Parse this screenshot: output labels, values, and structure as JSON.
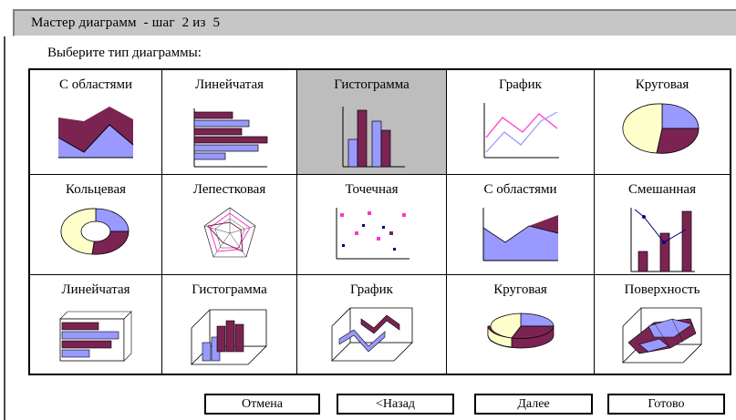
{
  "window": {
    "title": "Мастер диаграмм  - шаг  2 из  5"
  },
  "prompt": "Выберите тип диаграммы:",
  "chart_types": [
    {
      "label": "С областями",
      "icon": "area-chart-icon"
    },
    {
      "label": "Линейчатая",
      "icon": "bar-chart-icon"
    },
    {
      "label": "Гистограмма",
      "icon": "column-chart-icon",
      "selected": true
    },
    {
      "label": "График",
      "icon": "line-chart-icon"
    },
    {
      "label": "Круговая",
      "icon": "pie-chart-icon"
    },
    {
      "label": "Кольцевая",
      "icon": "doughnut-chart-icon"
    },
    {
      "label": "Лепестковая",
      "icon": "radar-chart-icon"
    },
    {
      "label": "Точечная",
      "icon": "scatter-chart-icon"
    },
    {
      "label": "С областями",
      "icon": "area-3d-chart-icon"
    },
    {
      "label": "Смешанная",
      "icon": "combo-chart-icon"
    },
    {
      "label": "Линейчатая",
      "icon": "bar-3d-chart-icon"
    },
    {
      "label": "Гистограмма",
      "icon": "column-3d-chart-icon"
    },
    {
      "label": "График",
      "icon": "line-3d-chart-icon"
    },
    {
      "label": "Круговая",
      "icon": "pie-3d-chart-icon"
    },
    {
      "label": "Поверхность",
      "icon": "surface-chart-icon"
    }
  ],
  "buttons": {
    "cancel": "Отмена",
    "back": "<Назад",
    "next": "Далее",
    "finish": "Готово"
  },
  "colors": {
    "purple": "#7b2452",
    "blue": "#9999ff",
    "pink": "#ff33cc",
    "cream": "#ffffcc",
    "selected_bg": "#bdbdbd",
    "titlebar_bg": "#c6c6c6"
  }
}
